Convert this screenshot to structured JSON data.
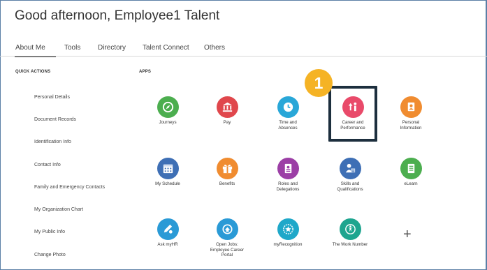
{
  "greeting": "Good afternoon, Employee1 Talent",
  "tabs": [
    "About Me",
    "Tools",
    "Directory",
    "Talent Connect",
    "Others"
  ],
  "quick_actions": {
    "title": "QUICK ACTIONS",
    "items": [
      "Personal Details",
      "Document Records",
      "Identification Info",
      "Contact Info",
      "Family and Emergency Contacts",
      "My Organization Chart",
      "My Public Info",
      "Change Photo"
    ]
  },
  "apps": {
    "title": "APPS",
    "items": [
      {
        "label": "Journeys",
        "icon": "compass-icon",
        "color": "#4cae4f"
      },
      {
        "label": "Pay",
        "icon": "bank-icon",
        "color": "#e0474c"
      },
      {
        "label": "Time and Absences",
        "icon": "clock-icon",
        "color": "#29a7d8"
      },
      {
        "label": "Career and Performance",
        "icon": "career-icon",
        "color": "#e94a6a"
      },
      {
        "label": "Personal Information",
        "icon": "person-icon",
        "color": "#f08c30"
      },
      {
        "label": "My Schedule",
        "icon": "calendar-icon",
        "color": "#3e6fb5"
      },
      {
        "label": "Benefits",
        "icon": "gift-icon",
        "color": "#f08c30"
      },
      {
        "label": "Roles and Delegations",
        "icon": "id-badge-icon",
        "color": "#9c3fa6"
      },
      {
        "label": "Skills and Qualifications",
        "icon": "skills-icon",
        "color": "#3e6fb5"
      },
      {
        "label": "eLearn",
        "icon": "notebook-icon",
        "color": "#4cae4f"
      },
      {
        "label": "Ask myHR",
        "icon": "chat-pen-icon",
        "color": "#2a9ad6"
      },
      {
        "label": "Open Jobs: Employee Career Portal",
        "icon": "jobs-icon",
        "color": "#2a9ad6"
      },
      {
        "label": "myRecognition",
        "icon": "badge-star-icon",
        "color": "#1fa8c9"
      },
      {
        "label": "The Work Number",
        "icon": "accessibility-icon",
        "color": "#1ea58f"
      }
    ]
  },
  "callout": {
    "number": "1",
    "color": "#f5b325"
  }
}
